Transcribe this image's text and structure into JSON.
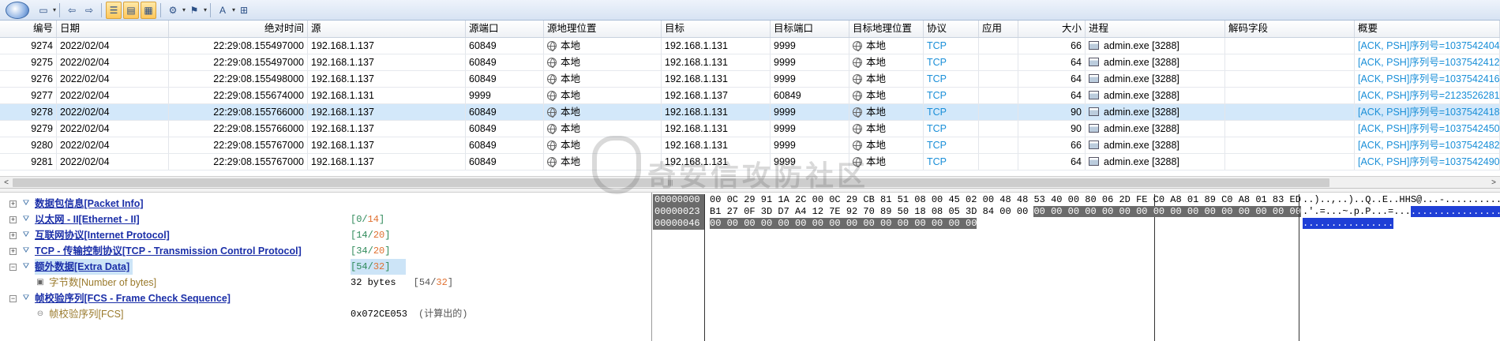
{
  "toolbar": {
    "buttons": [
      "save-icon",
      "back-icon",
      "forward-icon",
      "list-view-icon",
      "detail-view-icon",
      "hex-view-icon",
      "settings-icon",
      "filter-icon",
      "text-icon",
      "export-icon"
    ]
  },
  "table": {
    "columns": [
      "编号",
      "日期",
      "绝对时间",
      "源",
      "源端口",
      "源地理位置",
      "目标",
      "目标端口",
      "目标地理位置",
      "协议",
      "应用",
      "大小",
      "进程",
      "解码字段",
      "概要"
    ],
    "rows": [
      {
        "no": "9274",
        "date": "2022/02/04",
        "time": "22:29:08.155497000",
        "src": "192.168.1.137",
        "sport": "60849",
        "sgeo": "本地",
        "dst": "192.168.1.131",
        "dport": "9999",
        "dgeo": "本地",
        "proto": "TCP",
        "app": "",
        "size": "66",
        "proc": "admin.exe [3288]",
        "decode": "",
        "summary": "[ACK, PSH]序列号=1037542404,"
      },
      {
        "no": "9275",
        "date": "2022/02/04",
        "time": "22:29:08.155497000",
        "src": "192.168.1.137",
        "sport": "60849",
        "sgeo": "本地",
        "dst": "192.168.1.131",
        "dport": "9999",
        "dgeo": "本地",
        "proto": "TCP",
        "app": "",
        "size": "64",
        "proc": "admin.exe [3288]",
        "decode": "",
        "summary": "[ACK, PSH]序列号=1037542412,"
      },
      {
        "no": "9276",
        "date": "2022/02/04",
        "time": "22:29:08.155498000",
        "src": "192.168.1.137",
        "sport": "60849",
        "sgeo": "本地",
        "dst": "192.168.1.131",
        "dport": "9999",
        "dgeo": "本地",
        "proto": "TCP",
        "app": "",
        "size": "64",
        "proc": "admin.exe [3288]",
        "decode": "",
        "summary": "[ACK, PSH]序列号=1037542416,"
      },
      {
        "no": "9277",
        "date": "2022/02/04",
        "time": "22:29:08.155674000",
        "src": "192.168.1.131",
        "sport": "9999",
        "sgeo": "本地",
        "dst": "192.168.1.137",
        "dport": "60849",
        "dgeo": "本地",
        "proto": "TCP",
        "app": "",
        "size": "64",
        "proc": "admin.exe [3288]",
        "decode": "",
        "summary": "[ACK, PSH]序列号=2123526281,"
      },
      {
        "no": "9278",
        "date": "2022/02/04",
        "time": "22:29:08.155766000",
        "src": "192.168.1.137",
        "sport": "60849",
        "sgeo": "本地",
        "dst": "192.168.1.131",
        "dport": "9999",
        "dgeo": "本地",
        "proto": "TCP",
        "app": "",
        "size": "90",
        "proc": "admin.exe [3288]",
        "decode": "",
        "summary": "[ACK, PSH]序列号=1037542418,"
      },
      {
        "no": "9279",
        "date": "2022/02/04",
        "time": "22:29:08.155766000",
        "src": "192.168.1.137",
        "sport": "60849",
        "sgeo": "本地",
        "dst": "192.168.1.131",
        "dport": "9999",
        "dgeo": "本地",
        "proto": "TCP",
        "app": "",
        "size": "90",
        "proc": "admin.exe [3288]",
        "decode": "",
        "summary": "[ACK, PSH]序列号=1037542450,"
      },
      {
        "no": "9280",
        "date": "2022/02/04",
        "time": "22:29:08.155767000",
        "src": "192.168.1.137",
        "sport": "60849",
        "sgeo": "本地",
        "dst": "192.168.1.131",
        "dport": "9999",
        "dgeo": "本地",
        "proto": "TCP",
        "app": "",
        "size": "66",
        "proc": "admin.exe [3288]",
        "decode": "",
        "summary": "[ACK, PSH]序列号=1037542482,"
      },
      {
        "no": "9281",
        "date": "2022/02/04",
        "time": "22:29:08.155767000",
        "src": "192.168.1.137",
        "sport": "60849",
        "sgeo": "本地",
        "dst": "192.168.1.131",
        "dport": "9999",
        "dgeo": "本地",
        "proto": "TCP",
        "app": "",
        "size": "64",
        "proc": "admin.exe [3288]",
        "decode": "",
        "summary": "[ACK, PSH]序列号=1037542490,"
      }
    ],
    "selected_row": "9278"
  },
  "tree": {
    "items": [
      {
        "label": "数据包信息[Packet Info]",
        "range_a": "",
        "range_b": "",
        "value": ""
      },
      {
        "label": "以太网 - II[Ethernet - II]",
        "range_a": "0",
        "range_b": "14",
        "value": ""
      },
      {
        "label": "互联网协议[Internet Protocol]",
        "range_a": "14",
        "range_b": "20",
        "value": ""
      },
      {
        "label": "TCP - 传输控制协议[TCP - Transmission Control Protocol]",
        "range_a": "34",
        "range_b": "20",
        "value": ""
      },
      {
        "label": "额外数据[Extra Data]",
        "range_a": "54",
        "range_b": "32",
        "value": ""
      },
      {
        "label": "字节数[Number of bytes]",
        "range_a": "54",
        "range_b": "32",
        "value": "32 bytes"
      },
      {
        "label": "帧校验序列[FCS - Frame Check Sequence]",
        "range_a": "",
        "range_b": "",
        "value": ""
      },
      {
        "label": "帧校验序列[FCS]",
        "range_a": "",
        "range_b": "",
        "value": "0x072CE053",
        "note": "(计算出的)"
      }
    ]
  },
  "hex": {
    "offsets": [
      "00000000",
      "00000023",
      "00000046"
    ],
    "line1": "00 0C 29 91 1A 2C 00 0C 29 CB 81 51 08 00 45 02 00 48 48 53 40 00 80 06 2D FE C0 A8 01 89 C0 A8 01 83 ED",
    "line2a": "B1 27 0F 3D D7 A4 12 7E 92 70 89 50 18 08 05 3D 84 00 00 ",
    "line2b": "00 00 00 00 00 00 00 00 00 00 00 00 00 00 00 00",
    "line3": "00 00 00 00 00 00 00 00 00 00 00 00 00 00 00 00",
    "ascii1": "..)..,..)..Q..E..HHS@...-...........",
    "ascii2a": ".'.=...~.p.P...=...",
    "ascii2b": "................",
    "ascii3": "................"
  },
  "watermark": "奇安信攻防社区"
}
